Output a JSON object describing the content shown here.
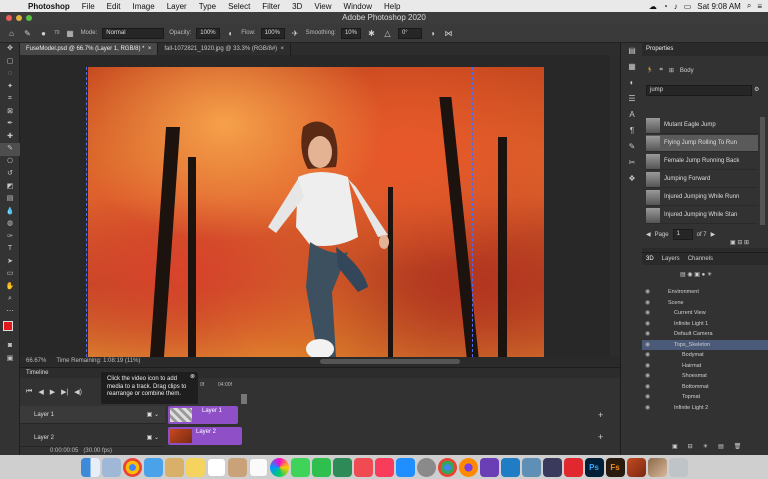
{
  "menubar": {
    "app_name": "Photoshop",
    "items": [
      "File",
      "Edit",
      "Image",
      "Layer",
      "Type",
      "Select",
      "Filter",
      "3D",
      "View",
      "Window",
      "Help"
    ],
    "clock": "Sat 9:08 AM"
  },
  "window": {
    "title": "Adobe Photoshop 2020"
  },
  "options_bar": {
    "brush_size": "70",
    "mode_label": "Mode:",
    "mode_value": "Normal",
    "opacity_label": "Opacity:",
    "opacity_value": "100%",
    "flow_label": "Flow:",
    "flow_value": "100%",
    "smoothing_label": "Smoothing:",
    "smoothing_value": "10%",
    "angle_value": "0°"
  },
  "doc_tabs": [
    {
      "label": "FuseModel.psd @ 66.7% (Layer 1, RGB/8) *",
      "active": true
    },
    {
      "label": "fall-1072821_1920.jpg @ 33.3% (RGB/8#)",
      "active": false
    }
  ],
  "status": {
    "zoom": "66.67%",
    "time_remaining": "Time Remaining: 1:08:19 (11%)"
  },
  "timeline": {
    "title": "Timeline",
    "ruler_marks": [
      "0f",
      "04:00f"
    ],
    "tracks": [
      {
        "label": "Layer 1",
        "clip": "Layer 1"
      },
      {
        "label": "Layer 2",
        "clip": "Layer 2"
      }
    ],
    "timecode": "0:00:00:05",
    "fps": "(30.00 fps)",
    "tooltip": "Click the video icon to add media to a track. Drag clips to rearrange or combine them."
  },
  "properties": {
    "title": "Properties",
    "body_label": "Body",
    "search_value": "jump",
    "items": [
      {
        "label": "Mutant Eagle Jump",
        "selected": false
      },
      {
        "label": "Flying Jump Rolling To Run",
        "selected": true
      },
      {
        "label": "Female Jump Running Back",
        "selected": false
      },
      {
        "label": "Jumping Forward",
        "selected": false
      },
      {
        "label": "Injured Jumping While Runn",
        "selected": false
      },
      {
        "label": "Injured Jumping While Stan",
        "selected": false
      }
    ],
    "page_label": "Page",
    "page_value": "1",
    "page_of": "of 7"
  },
  "layers_panel": {
    "tabs": [
      "3D",
      "Layers",
      "Channels"
    ],
    "rows": [
      {
        "label": "Environment",
        "indent": 0,
        "selected": false
      },
      {
        "label": "Scene",
        "indent": 0,
        "selected": false
      },
      {
        "label": "Current View",
        "indent": 1,
        "selected": false
      },
      {
        "label": "Infinite Light 1",
        "indent": 1,
        "selected": false
      },
      {
        "label": "Default Camera",
        "indent": 1,
        "selected": false
      },
      {
        "label": "Tops_Skeleton",
        "indent": 1,
        "selected": true
      },
      {
        "label": "Bodymat",
        "indent": 2,
        "selected": false
      },
      {
        "label": "Hairmat",
        "indent": 2,
        "selected": false
      },
      {
        "label": "Shoesmat",
        "indent": 2,
        "selected": false
      },
      {
        "label": "Bottommat",
        "indent": 2,
        "selected": false
      },
      {
        "label": "Topmat",
        "indent": 2,
        "selected": false
      },
      {
        "label": "Infinite Light 2",
        "indent": 1,
        "selected": false
      }
    ]
  },
  "dock": {
    "apps": [
      "finder-icon",
      "launchpad-icon",
      "chrome-icon",
      "mail-icon",
      "books-icon",
      "notes-icon",
      "calendar-icon",
      "contacts-icon",
      "reminders-icon",
      "photos-icon",
      "messages-icon",
      "facetime-icon",
      "numbers-icon",
      "news-icon",
      "music-icon",
      "appstore-icon",
      "settings-icon",
      "chrome2-icon",
      "firefox-icon",
      "vs-icon",
      "vscode-icon",
      "preview-icon",
      "xcode-icon",
      "creativecloud-icon",
      "photoshop-icon",
      "fuse-icon",
      "image1-icon",
      "image2-icon",
      "trash-icon"
    ],
    "ps_label": "Ps",
    "fs_label": "Fs"
  },
  "colors": {
    "accent": "#4a6cf0",
    "clip_purple": "#8e4fc7",
    "selection": "#4a5a78"
  }
}
